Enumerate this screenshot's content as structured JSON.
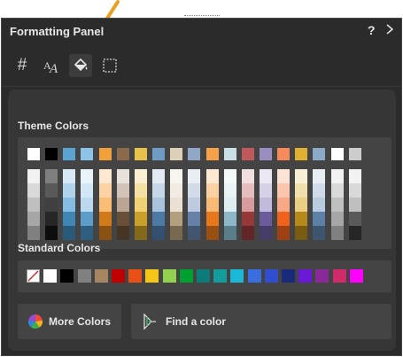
{
  "panel": {
    "title": "Formatting Panel",
    "help_label": "?",
    "collapse_icon": "chevron-right-icon"
  },
  "toolbar": {
    "tabs": [
      {
        "icon": "hash-icon",
        "label": "#"
      },
      {
        "icon": "text-format-icon",
        "label": ""
      },
      {
        "icon": "paint-bucket-icon",
        "label": ""
      },
      {
        "icon": "border-icon",
        "label": ""
      }
    ]
  },
  "theme": {
    "label": "Theme Colors",
    "top_colors": [
      "#ffffff",
      "#000000",
      "#5ba3d0",
      "#8cc4e8",
      "#f2a03a",
      "#8b6a4c",
      "#e8c24a",
      "#6f9bc4",
      "#ddd0b8",
      "#90a7c8",
      "#f7a04a",
      "#c8e0e8",
      "#c05a5a",
      "#9a8dc2",
      "#f78a5a",
      "#e0b030",
      "#8aa8c8",
      "#ffffff",
      "#cccccc"
    ],
    "columns": [
      [
        "#f2f2f2",
        "#d9d9d9",
        "#bfbfbf",
        "#a6a6a6",
        "#808080"
      ],
      [
        "#7f7f7f",
        "#595959",
        "#404040",
        "#262626",
        "#0d0d0d"
      ],
      [
        "#d6e9f5",
        "#aed3eb",
        "#85bde2",
        "#3f86b5",
        "#2a5a79"
      ],
      [
        "#e8f3fa",
        "#d1e7f5",
        "#bad9ef",
        "#5c9ecb",
        "#2f5f80"
      ],
      [
        "#fde9d1",
        "#fbd3a4",
        "#f9bd76",
        "#d07a1a",
        "#8a5212"
      ],
      [
        "#e8e1db",
        "#d1c3b7",
        "#baa594",
        "#6a4f38",
        "#463425"
      ],
      [
        "#faf0d1",
        "#f5e1a4",
        "#f0d276",
        "#c8a02a",
        "#85691b"
      ],
      [
        "#e2ebf3",
        "#c5d7e8",
        "#a9c3dc",
        "#4c7aa5",
        "#33516e"
      ],
      [
        "#f8f5f0",
        "#f1ebe2",
        "#ebe0d4",
        "#b39f7e",
        "#77694f"
      ],
      [
        "#e9edf4",
        "#d3dbe9",
        "#bdc9de",
        "#6581a8",
        "#435670"
      ],
      [
        "#fde8d1",
        "#fbd1a4",
        "#f9ba76",
        "#e8761a",
        "#9a4f12"
      ],
      [
        "#f4f9fa",
        "#e9f2f5",
        "#dfecf0",
        "#8cb8c8",
        "#5a7d8a"
      ],
      [
        "#f2dede",
        "#e6bdbd",
        "#d99c9c",
        "#943838",
        "#632525"
      ],
      [
        "#ebe8f3",
        "#d7d1e7",
        "#c3badb",
        "#6c5b9d",
        "#483d69"
      ],
      [
        "#fde2d6",
        "#fbc5ae",
        "#f9a885",
        "#f0621c",
        "#a04113"
      ],
      [
        "#f8efd5",
        "#f1dfab",
        "#ebcf82",
        "#b58a18",
        "#795c10"
      ],
      [
        "#e8eef4",
        "#d0dce9",
        "#b9cbdf",
        "#5c80a6",
        "#3e556f"
      ],
      [
        "#f2f2f2",
        "#d9d9d9",
        "#bfbfbf",
        "#a6a6a6",
        "#808080"
      ],
      [
        "#f2f2f2",
        "#d9d9d9",
        "#bfbfbf",
        "#595959",
        "#262626"
      ]
    ]
  },
  "standard": {
    "label": "Standard Colors",
    "colors": [
      "none",
      "#ffffff",
      "#000000",
      "#808080",
      "#a68660",
      "#c00000",
      "#e85016",
      "#f5c518",
      "#92d050",
      "#00a030",
      "#0f7a7a",
      "#139c9c",
      "#1ab8d6",
      "#3a6ee0",
      "#2f4fd0",
      "#1a2a7a",
      "#6a1ad6",
      "#8a2a9a",
      "#d02a6a",
      "#ff00ff"
    ]
  },
  "buttons": {
    "more_colors": "More Colors",
    "find_color": "Find a color"
  }
}
